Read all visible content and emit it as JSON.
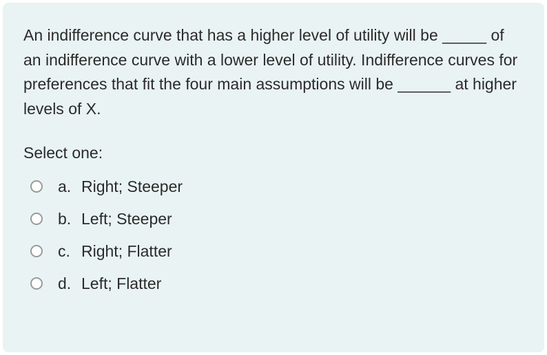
{
  "question": "An indifference curve that has a higher level of utility will be _____ of an indifference curve with a lower level of utility. Indifference curves for preferences that fit the four main assumptions will be ______ at higher levels of X.",
  "prompt": "Select one:",
  "options": [
    {
      "letter": "a.",
      "text": "Right; Steeper"
    },
    {
      "letter": "b.",
      "text": "Left; Steeper"
    },
    {
      "letter": "c.",
      "text": "Right; Flatter"
    },
    {
      "letter": "d.",
      "text": "Left; Flatter"
    }
  ]
}
